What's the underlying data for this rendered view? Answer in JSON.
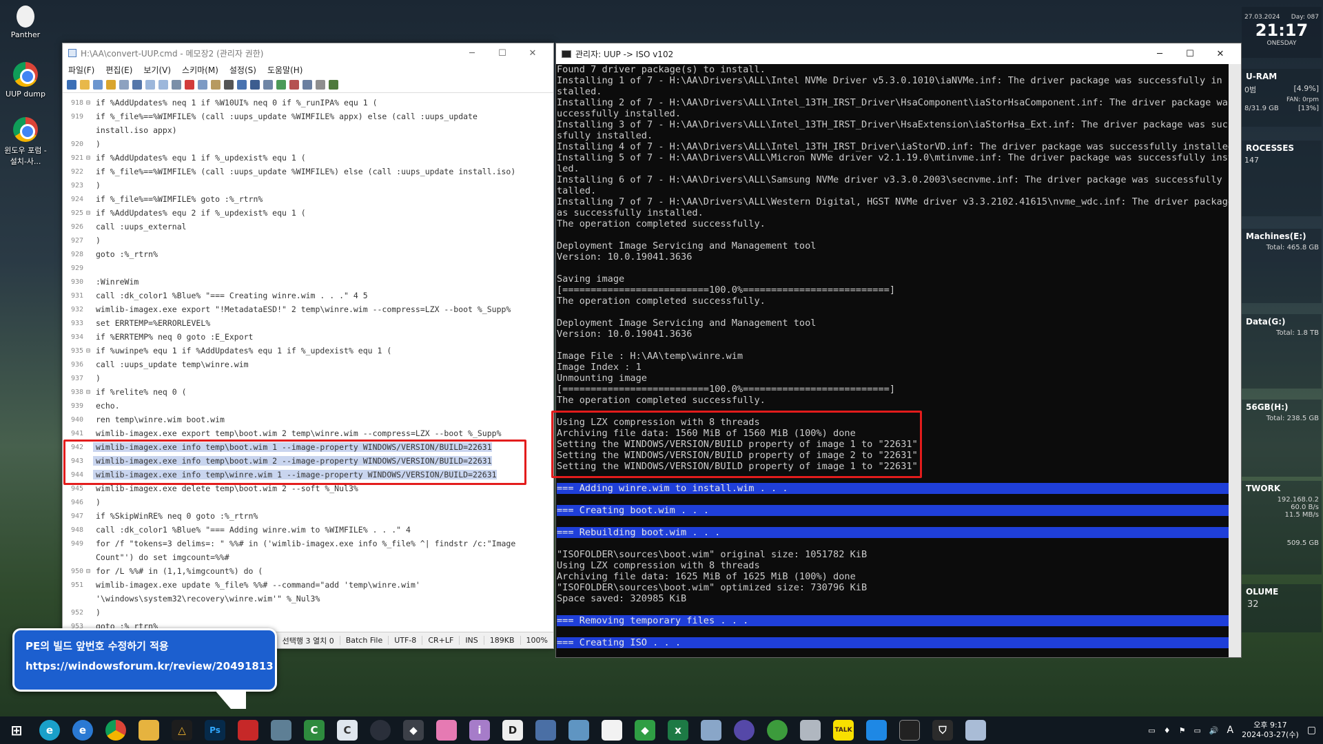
{
  "desktop": {
    "icons": [
      {
        "label": "Panther"
      },
      {
        "label": "UUP dump"
      },
      {
        "label": "윈도우 포럼 - 설치-사..."
      }
    ]
  },
  "notepad": {
    "title": "H:\\AA\\convert-UUP.cmd - 메모장2 (관리자 권한)",
    "menu": [
      "파일(F)",
      "편집(E)",
      "보기(V)",
      "스키마(M)",
      "설정(S)",
      "도움말(H)"
    ],
    "lines": [
      {
        "n": "918",
        "f": "⊟",
        "t": "if %AddUpdates% neq 1 if %W10UI% neq 0 if %_runIPA% equ 1 ("
      },
      {
        "n": "919",
        "f": "",
        "t": "if %_file%==%WIMFILE% (call :uups_update %WIMFILE% appx) else (call :uups_update"
      },
      {
        "n": "",
        "f": "",
        "t": "install.iso appx)"
      },
      {
        "n": "920",
        "f": "",
        "t": ")"
      },
      {
        "n": "921",
        "f": "⊟",
        "t": "if %AddUpdates% equ 1 if %_updexist% equ 1 ("
      },
      {
        "n": "922",
        "f": "",
        "t": "if %_file%==%WIMFILE% (call :uups_update %WIMFILE%) else (call :uups_update install.iso)"
      },
      {
        "n": "923",
        "f": "",
        "t": ")"
      },
      {
        "n": "924",
        "f": "",
        "t": "if %_file%==%WIMFILE% goto :%_rtrn%"
      },
      {
        "n": "925",
        "f": "⊟",
        "t": "if %AddUpdates% equ 2 if %_updexist% equ 1 ("
      },
      {
        "n": "926",
        "f": "",
        "t": "call :uups_external"
      },
      {
        "n": "927",
        "f": "",
        "t": ")"
      },
      {
        "n": "928",
        "f": "",
        "t": "goto :%_rtrn%"
      },
      {
        "n": "929",
        "f": "",
        "t": ""
      },
      {
        "n": "930",
        "f": "",
        "t": ":WinreWim"
      },
      {
        "n": "931",
        "f": "",
        "t": "call :dk_color1 %Blue% \"=== Creating winre.wim . . .\" 4 5"
      },
      {
        "n": "932",
        "f": "",
        "t": "wimlib-imagex.exe export \"!MetadataESD!\" 2 temp\\winre.wim --compress=LZX --boot %_Supp%"
      },
      {
        "n": "933",
        "f": "",
        "t": "set ERRTEMP=%ERRORLEVEL%"
      },
      {
        "n": "934",
        "f": "",
        "t": "if %ERRTEMP% neq 0 goto :E_Export"
      },
      {
        "n": "935",
        "f": "⊟",
        "t": "if %uwinpe% equ 1 if %AddUpdates% equ 1 if %_updexist% equ 1 ("
      },
      {
        "n": "936",
        "f": "",
        "t": "call :uups_update temp\\winre.wim"
      },
      {
        "n": "937",
        "f": "",
        "t": ")"
      },
      {
        "n": "938",
        "f": "⊟",
        "t": "if %relite% neq 0 ("
      },
      {
        "n": "939",
        "f": "",
        "t": "echo."
      },
      {
        "n": "940",
        "f": "",
        "t": "ren temp\\winre.wim boot.wim"
      },
      {
        "n": "941",
        "f": "",
        "t": "wimlib-imagex.exe export temp\\boot.wim 2 temp\\winre.wim --compress=LZX --boot %_Supp%"
      },
      {
        "n": "942",
        "f": "",
        "t": "wimlib-imagex.exe info temp\\boot.wim 1 --image-property WINDOWS/VERSION/BUILD=22631",
        "sel": true
      },
      {
        "n": "943",
        "f": "",
        "t": "wimlib-imagex.exe info temp\\boot.wim 2 --image-property WINDOWS/VERSION/BUILD=22631",
        "sel": true
      },
      {
        "n": "944",
        "f": "",
        "t": "wimlib-imagex.exe info temp\\winre.wim 1 --image-property WINDOWS/VERSION/BUILD=22631",
        "sel": true
      },
      {
        "n": "945",
        "f": "",
        "t": "wimlib-imagex.exe delete temp\\boot.wim 2 --soft %_Nul3%"
      },
      {
        "n": "946",
        "f": "",
        "t": ")"
      },
      {
        "n": "947",
        "f": "",
        "t": "if %SkipWinRE% neq 0 goto :%_rtrn%"
      },
      {
        "n": "948",
        "f": "",
        "t": "call :dk_color1 %Blue% \"=== Adding winre.wim to %WIMFILE% . . .\" 4"
      },
      {
        "n": "949",
        "f": "",
        "t": "for /f \"tokens=3 delims=: \" %%# in ('wimlib-imagex.exe info %_file% ^| findstr /c:\"Image"
      },
      {
        "n": "",
        "f": "",
        "t": "Count\"') do set imgcount=%%#"
      },
      {
        "n": "950",
        "f": "⊟",
        "t": "for /L %%# in (1,1,%imgcount%) do ("
      },
      {
        "n": "951",
        "f": "",
        "t": "  wimlib-imagex.exe update %_file% %%# --command=\"add 'temp\\winre.wim'"
      },
      {
        "n": "",
        "f": "",
        "t": "'\\windows\\system32\\recovery\\winre.wim'\" %_Nul3%"
      },
      {
        "n": "952",
        "f": "",
        "t": ")"
      },
      {
        "n": "953",
        "f": "",
        "t": "goto :%_rtrn%"
      }
    ],
    "status": [
      "선택행 3 열치 0",
      "Batch File",
      "UTF-8",
      "CR+LF",
      "INS",
      "189KB",
      "100%"
    ]
  },
  "console": {
    "title": "관리자:  UUP -> ISO v102",
    "lines": [
      {
        "t": "Found 7 driver package(s) to install."
      },
      {
        "t": "Installing 1 of 7 - H:\\AA\\Drivers\\ALL\\Intel NVMe Driver v5.3.0.1010\\iaNVMe.inf: The driver package was successfully in"
      },
      {
        "t": "stalled."
      },
      {
        "t": "Installing 2 of 7 - H:\\AA\\Drivers\\ALL\\Intel_13TH_IRST_Driver\\HsaComponent\\iaStorHsaComponent.inf: The driver package was s"
      },
      {
        "t": "uccessfully installed."
      },
      {
        "t": "Installing 3 of 7 - H:\\AA\\Drivers\\ALL\\Intel_13TH_IRST_Driver\\HsaExtension\\iaStorHsa_Ext.inf: The driver package was succes"
      },
      {
        "t": "sfully installed."
      },
      {
        "t": "Installing 4 of 7 - H:\\AA\\Drivers\\ALL\\Intel_13TH_IRST_Driver\\iaStorVD.inf: The driver package was successfully installed."
      },
      {
        "t": "Installing 5 of 7 - H:\\AA\\Drivers\\ALL\\Micron NVMe driver v2.1.19.0\\mtinvme.inf: The driver package was successfully instal"
      },
      {
        "t": "led."
      },
      {
        "t": "Installing 6 of 7 - H:\\AA\\Drivers\\ALL\\Samsung NVMe driver v3.3.0.2003\\secnvme.inf: The driver package was successfully ins"
      },
      {
        "t": "talled."
      },
      {
        "t": "Installing 7 of 7 - H:\\AA\\Drivers\\ALL\\Western Digital, HGST NVMe driver v3.3.2102.41615\\nvme_wdc.inf: The driver package w"
      },
      {
        "t": "as successfully installed."
      },
      {
        "t": "The operation completed successfully."
      },
      {
        "t": ""
      },
      {
        "t": "Deployment Image Servicing and Management tool"
      },
      {
        "t": "Version: 10.0.19041.3636"
      },
      {
        "t": ""
      },
      {
        "t": "Saving image"
      },
      {
        "t": "[==========================100.0%==========================]"
      },
      {
        "t": "The operation completed successfully."
      },
      {
        "t": ""
      },
      {
        "t": "Deployment Image Servicing and Management tool"
      },
      {
        "t": "Version: 10.0.19041.3636"
      },
      {
        "t": ""
      },
      {
        "t": "Image File : H:\\AA\\temp\\winre.wim"
      },
      {
        "t": "Image Index : 1"
      },
      {
        "t": "Unmounting image"
      },
      {
        "t": "[==========================100.0%==========================]"
      },
      {
        "t": "The operation completed successfully."
      },
      {
        "t": ""
      },
      {
        "t": "Using LZX compression with 8 threads"
      },
      {
        "t": "Archiving file data: 1560 MiB of 1560 MiB (100%) done"
      },
      {
        "t": "Setting the WINDOWS/VERSION/BUILD property of image 1 to \"22631\"."
      },
      {
        "t": "Setting the WINDOWS/VERSION/BUILD property of image 2 to \"22631\"."
      },
      {
        "t": "Setting the WINDOWS/VERSION/BUILD property of image 1 to \"22631\"."
      },
      {
        "t": ""
      },
      {
        "t": "=== Adding winre.wim to install.wim . . .",
        "hl": true
      },
      {
        "t": ""
      },
      {
        "t": "=== Creating boot.wim . . .",
        "hl": true
      },
      {
        "t": ""
      },
      {
        "t": "=== Rebuilding boot.wim . . .",
        "hl": true
      },
      {
        "t": ""
      },
      {
        "t": "\"ISOFOLDER\\sources\\boot.wim\" original size: 1051782 KiB"
      },
      {
        "t": "Using LZX compression with 8 threads"
      },
      {
        "t": "Archiving file data: 1625 MiB of 1625 MiB (100%) done"
      },
      {
        "t": "\"ISOFOLDER\\sources\\boot.wim\" optimized size: 730796 KiB"
      },
      {
        "t": "Space saved: 320985 KiB"
      },
      {
        "t": ""
      },
      {
        "t": "=== Removing temporary files . . .",
        "hl": true
      },
      {
        "t": ""
      },
      {
        "t": "=== Creating ISO . . .",
        "hl": true
      }
    ]
  },
  "widgets": {
    "date": "27.03.2024",
    "day": "Day: 087",
    "time": "21:17",
    "weekday": "ONESDAY",
    "ram": {
      "title": "U-RAM",
      "value": "0범",
      "pct": "[4.9%]",
      "fan": "FAN: 0rpm",
      "mem": "8/31.9 GB",
      "mem_pct": "[13%]"
    },
    "proc": {
      "title": "ROCESSES",
      "count": "147"
    },
    "drives": [
      {
        "title": "Machines(E:)",
        "total": "Total: 465.8 GB"
      },
      {
        "title": "Data(G:)",
        "total": "Total: 1.8 TB"
      },
      {
        "title": "56GB(H:)",
        "total": "Total: 238.5 GB"
      }
    ],
    "network": {
      "title": "TWORK",
      "ip": "192.168.0.2",
      "speed": "60.0 B/s",
      "peak": "11.5 MB/s",
      "total": "509.5 GB"
    },
    "volume": {
      "title": "OLUME",
      "value": "32"
    }
  },
  "callout": {
    "line1": "PE의 빌드 앞번호 수정하기 적용",
    "line2": "https://windowsforum.kr/review/20491813"
  },
  "taskbar": {
    "clock_time": "오후 9:17",
    "clock_date": "2024-03-27(수)",
    "ime": "A"
  }
}
